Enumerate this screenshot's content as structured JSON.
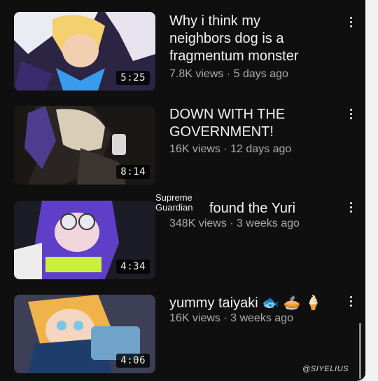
{
  "videos": [
    {
      "title_lines": [
        "Why i think my",
        "neighbors dog is a",
        "fragmentum monster"
      ],
      "views": "7.8K views",
      "age": "5 days ago",
      "duration": "5:25",
      "thumb_colors": [
        "#e9ecf2",
        "#3c2a6e",
        "#f5d06e",
        "#3aa8ff"
      ]
    },
    {
      "title_lines": [
        "DOWN WITH THE",
        "GOVERNMENT!"
      ],
      "views": "16K views",
      "age": "12 days ago",
      "duration": "8:14",
      "thumb_colors": [
        "#2a2522",
        "#1a1714",
        "#d8cdb6",
        "#4d3d8e"
      ]
    },
    {
      "tag_lines": [
        "Supreme",
        "Guardian"
      ],
      "title_lines": [
        "found the Yuri"
      ],
      "views": "348K views",
      "age": "3 weeks ago",
      "duration": "4:34",
      "thumb_colors": [
        "#1b1c26",
        "#5f3fc7",
        "#e8e8f0",
        "#c8f03c"
      ]
    },
    {
      "title_lines": [
        "yummy taiyaki 🐟 🥧 🍦"
      ],
      "views": "16K views",
      "age": "3 weeks ago",
      "duration": "4:06",
      "thumb_colors": [
        "#3c3f55",
        "#f0b24a",
        "#1f3d6a",
        "#7fc6e6"
      ]
    }
  ],
  "separator": " · ",
  "menu_icon": "vertical-ellipsis-icon",
  "watermark": "@SIYELIUS"
}
